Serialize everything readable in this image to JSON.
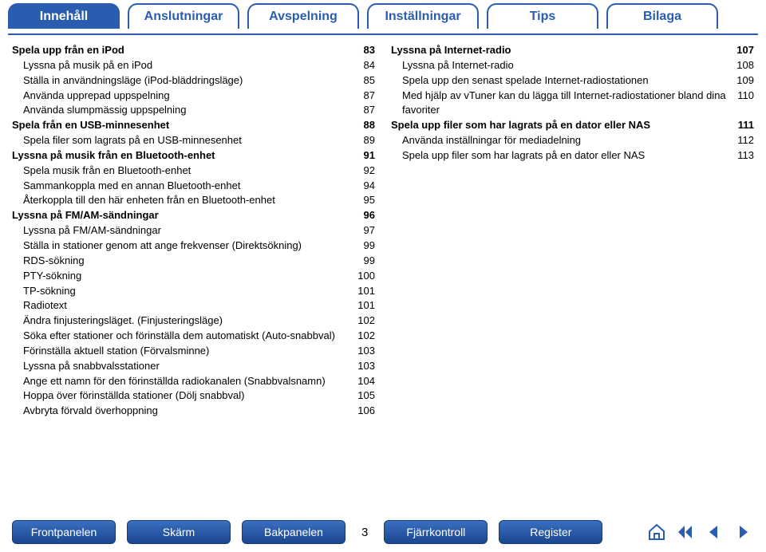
{
  "tabs": [
    "Innehåll",
    "Anslutningar",
    "Avspelning",
    "Inställningar",
    "Tips",
    "Bilaga"
  ],
  "active_tab": 0,
  "left_col": [
    {
      "label": "Spela upp från en iPod",
      "page": 83,
      "hdr": true
    },
    {
      "label": "Lyssna på musik på en iPod",
      "page": 84,
      "indent": true
    },
    {
      "label": "Ställa in användningsläge (iPod-bläddringsläge)",
      "page": 85,
      "indent": true
    },
    {
      "label": "Använda upprepad uppspelning",
      "page": 87,
      "indent": true
    },
    {
      "label": "Använda slumpmässig uppspelning",
      "page": 87,
      "indent": true
    },
    {
      "label": "Spela från en USB-minnesenhet",
      "page": 88,
      "hdr": true
    },
    {
      "label": "Spela filer som lagrats på en USB-minnesenhet",
      "page": 89,
      "indent": true
    },
    {
      "label": "Lyssna på musik från en Bluetooth-enhet",
      "page": 91,
      "hdr": true
    },
    {
      "label": "Spela musik från en Bluetooth-enhet",
      "page": 92,
      "indent": true
    },
    {
      "label": "Sammankoppla med en annan Bluetooth-enhet",
      "page": 94,
      "indent": true
    },
    {
      "label": "Återkoppla till den här enheten från en Bluetooth-enhet",
      "page": 95,
      "indent": true
    },
    {
      "label": "Lyssna på FM/AM-sändningar",
      "page": 96,
      "hdr": true
    },
    {
      "label": "Lyssna på FM/AM-sändningar",
      "page": 97,
      "indent": true
    },
    {
      "label": "Ställa in stationer genom att ange frekvenser (Direktsökning)",
      "page": 99,
      "indent": true
    },
    {
      "label": "RDS-sökning",
      "page": 99,
      "indent": true
    },
    {
      "label": "PTY-sökning",
      "page": 100,
      "indent": true
    },
    {
      "label": "TP-sökning",
      "page": 101,
      "indent": true
    },
    {
      "label": "Radiotext",
      "page": 101,
      "indent": true
    },
    {
      "label": "Ändra finjusteringsläget. (Finjusteringsläge)",
      "page": 102,
      "indent": true
    },
    {
      "label": "Söka efter stationer och förinställa dem automatiskt (Auto-snabbval)",
      "page": 102,
      "indent": true
    },
    {
      "label": "Förinställa aktuell station (Förvalsminne)",
      "page": 103,
      "indent": true
    },
    {
      "label": "Lyssna på snabbvalsstationer",
      "page": 103,
      "indent": true
    },
    {
      "label": "Ange ett namn för den förinställda radiokanalen (Snabbvalsnamn)",
      "page": 104,
      "indent": true
    },
    {
      "label": "Hoppa över förinställda stationer (Dölj snabbval)",
      "page": 105,
      "indent": true
    },
    {
      "label": "Avbryta förvald överhoppning",
      "page": 106,
      "indent": true
    }
  ],
  "right_col": [
    {
      "label": "Lyssna på Internet-radio",
      "page": 107,
      "hdr": true
    },
    {
      "label": "Lyssna på Internet-radio",
      "page": 108,
      "indent": true
    },
    {
      "label": "Spela upp den senast spelade Internet-radiostationen",
      "page": 109,
      "indent": true
    },
    {
      "label": "Med hjälp av vTuner kan du lägga till Internet-radiostationer bland dina favoriter",
      "page": 110,
      "indent": true
    },
    {
      "label": "Spela upp filer som har lagrats på en dator eller NAS",
      "page": 111,
      "hdr": true
    },
    {
      "label": "Använda inställningar för mediadelning",
      "page": 112,
      "indent": true
    },
    {
      "label": "Spela upp filer som har lagrats på en dator eller NAS",
      "page": 113,
      "indent": true
    }
  ],
  "bottom_buttons": [
    "Frontpanelen",
    "Skärm",
    "Bakpanelen",
    "Fjärrkontroll",
    "Register"
  ],
  "page_number": "3"
}
